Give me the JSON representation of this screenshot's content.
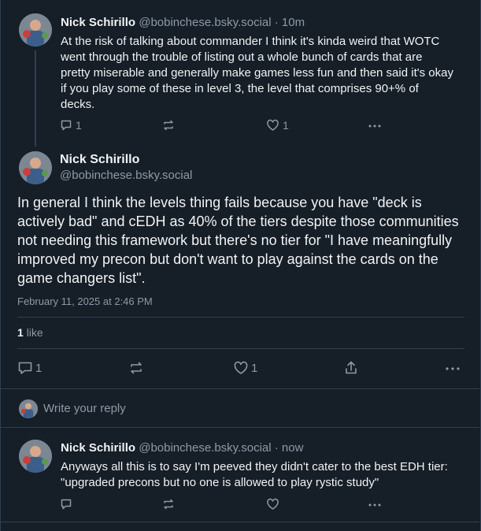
{
  "posts": [
    {
      "author": "Nick Schirillo",
      "handle": "@bobinchese.bsky.social",
      "time": "· 10m",
      "text": "At the risk of talking about commander I think it's kinda weird that WOTC went through the trouble of listing out a whole bunch of cards that are pretty miserable and generally make games less fun and then said it's okay if you play some of these in level 3, the level that comprises 90+% of decks.",
      "reply_count": "1",
      "like_count": "1"
    }
  ],
  "main_post": {
    "author": "Nick Schirillo",
    "handle": "@bobinchese.bsky.social",
    "text": "In general I think the levels thing fails because you have \"deck is actively bad\" and cEDH as 40% of the tiers despite those communities not needing this framework but there's no tier for \"I have meaningfully improved my precon but don't want to play against the cards on the game changers list\".",
    "timestamp": "February 11, 2025 at 2:46 PM",
    "likes_count": "1",
    "likes_label": "like",
    "reply_count": "1",
    "like_count": "1"
  },
  "reply_box": {
    "placeholder": "Write your reply"
  },
  "reply_post": {
    "author": "Nick Schirillo",
    "handle": "@bobinchese.bsky.social",
    "time": "· now",
    "text": "Anyways all this is to say I'm peeved they didn't cater to the best EDH tier: \"upgraded precons but no one is allowed to play rystic study\""
  },
  "icons": [
    "reply-icon",
    "repost-icon",
    "like-icon",
    "share-icon",
    "more-icon"
  ]
}
